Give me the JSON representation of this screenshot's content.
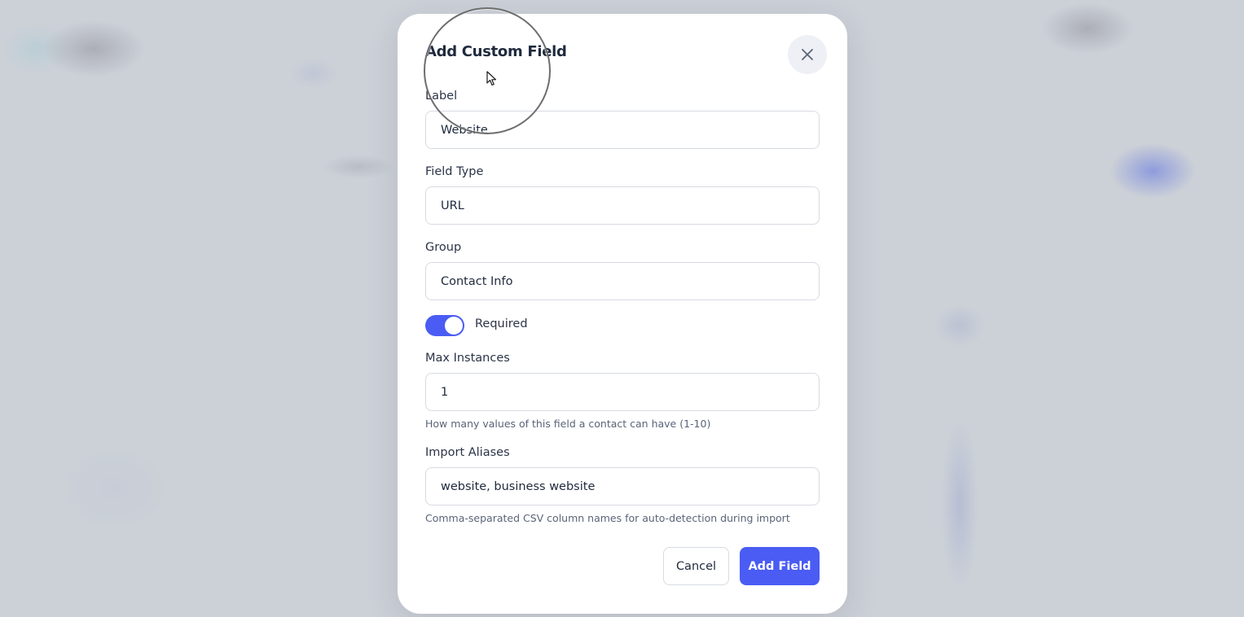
{
  "dialog": {
    "title": "Add Custom Field",
    "close_icon": "close-icon",
    "fields": {
      "label": {
        "label": "Label",
        "value": "Website"
      },
      "field_type": {
        "label": "Field Type",
        "value": "URL"
      },
      "group": {
        "label": "Group",
        "value": "Contact Info"
      },
      "required": {
        "label": "Required",
        "on": true
      },
      "max_instances": {
        "label": "Max Instances",
        "value": "1",
        "hint": "How many values of this field a contact can have (1-10)"
      },
      "import_aliases": {
        "label": "Import Aliases",
        "value": "website, business website",
        "hint": "Comma-separated CSV column names for auto-detection during import"
      }
    },
    "buttons": {
      "cancel": "Cancel",
      "submit": "Add Field"
    }
  },
  "colors": {
    "accent": "#4a5cf3",
    "text": "#1f2a3d",
    "border": "#d7dbe2"
  }
}
